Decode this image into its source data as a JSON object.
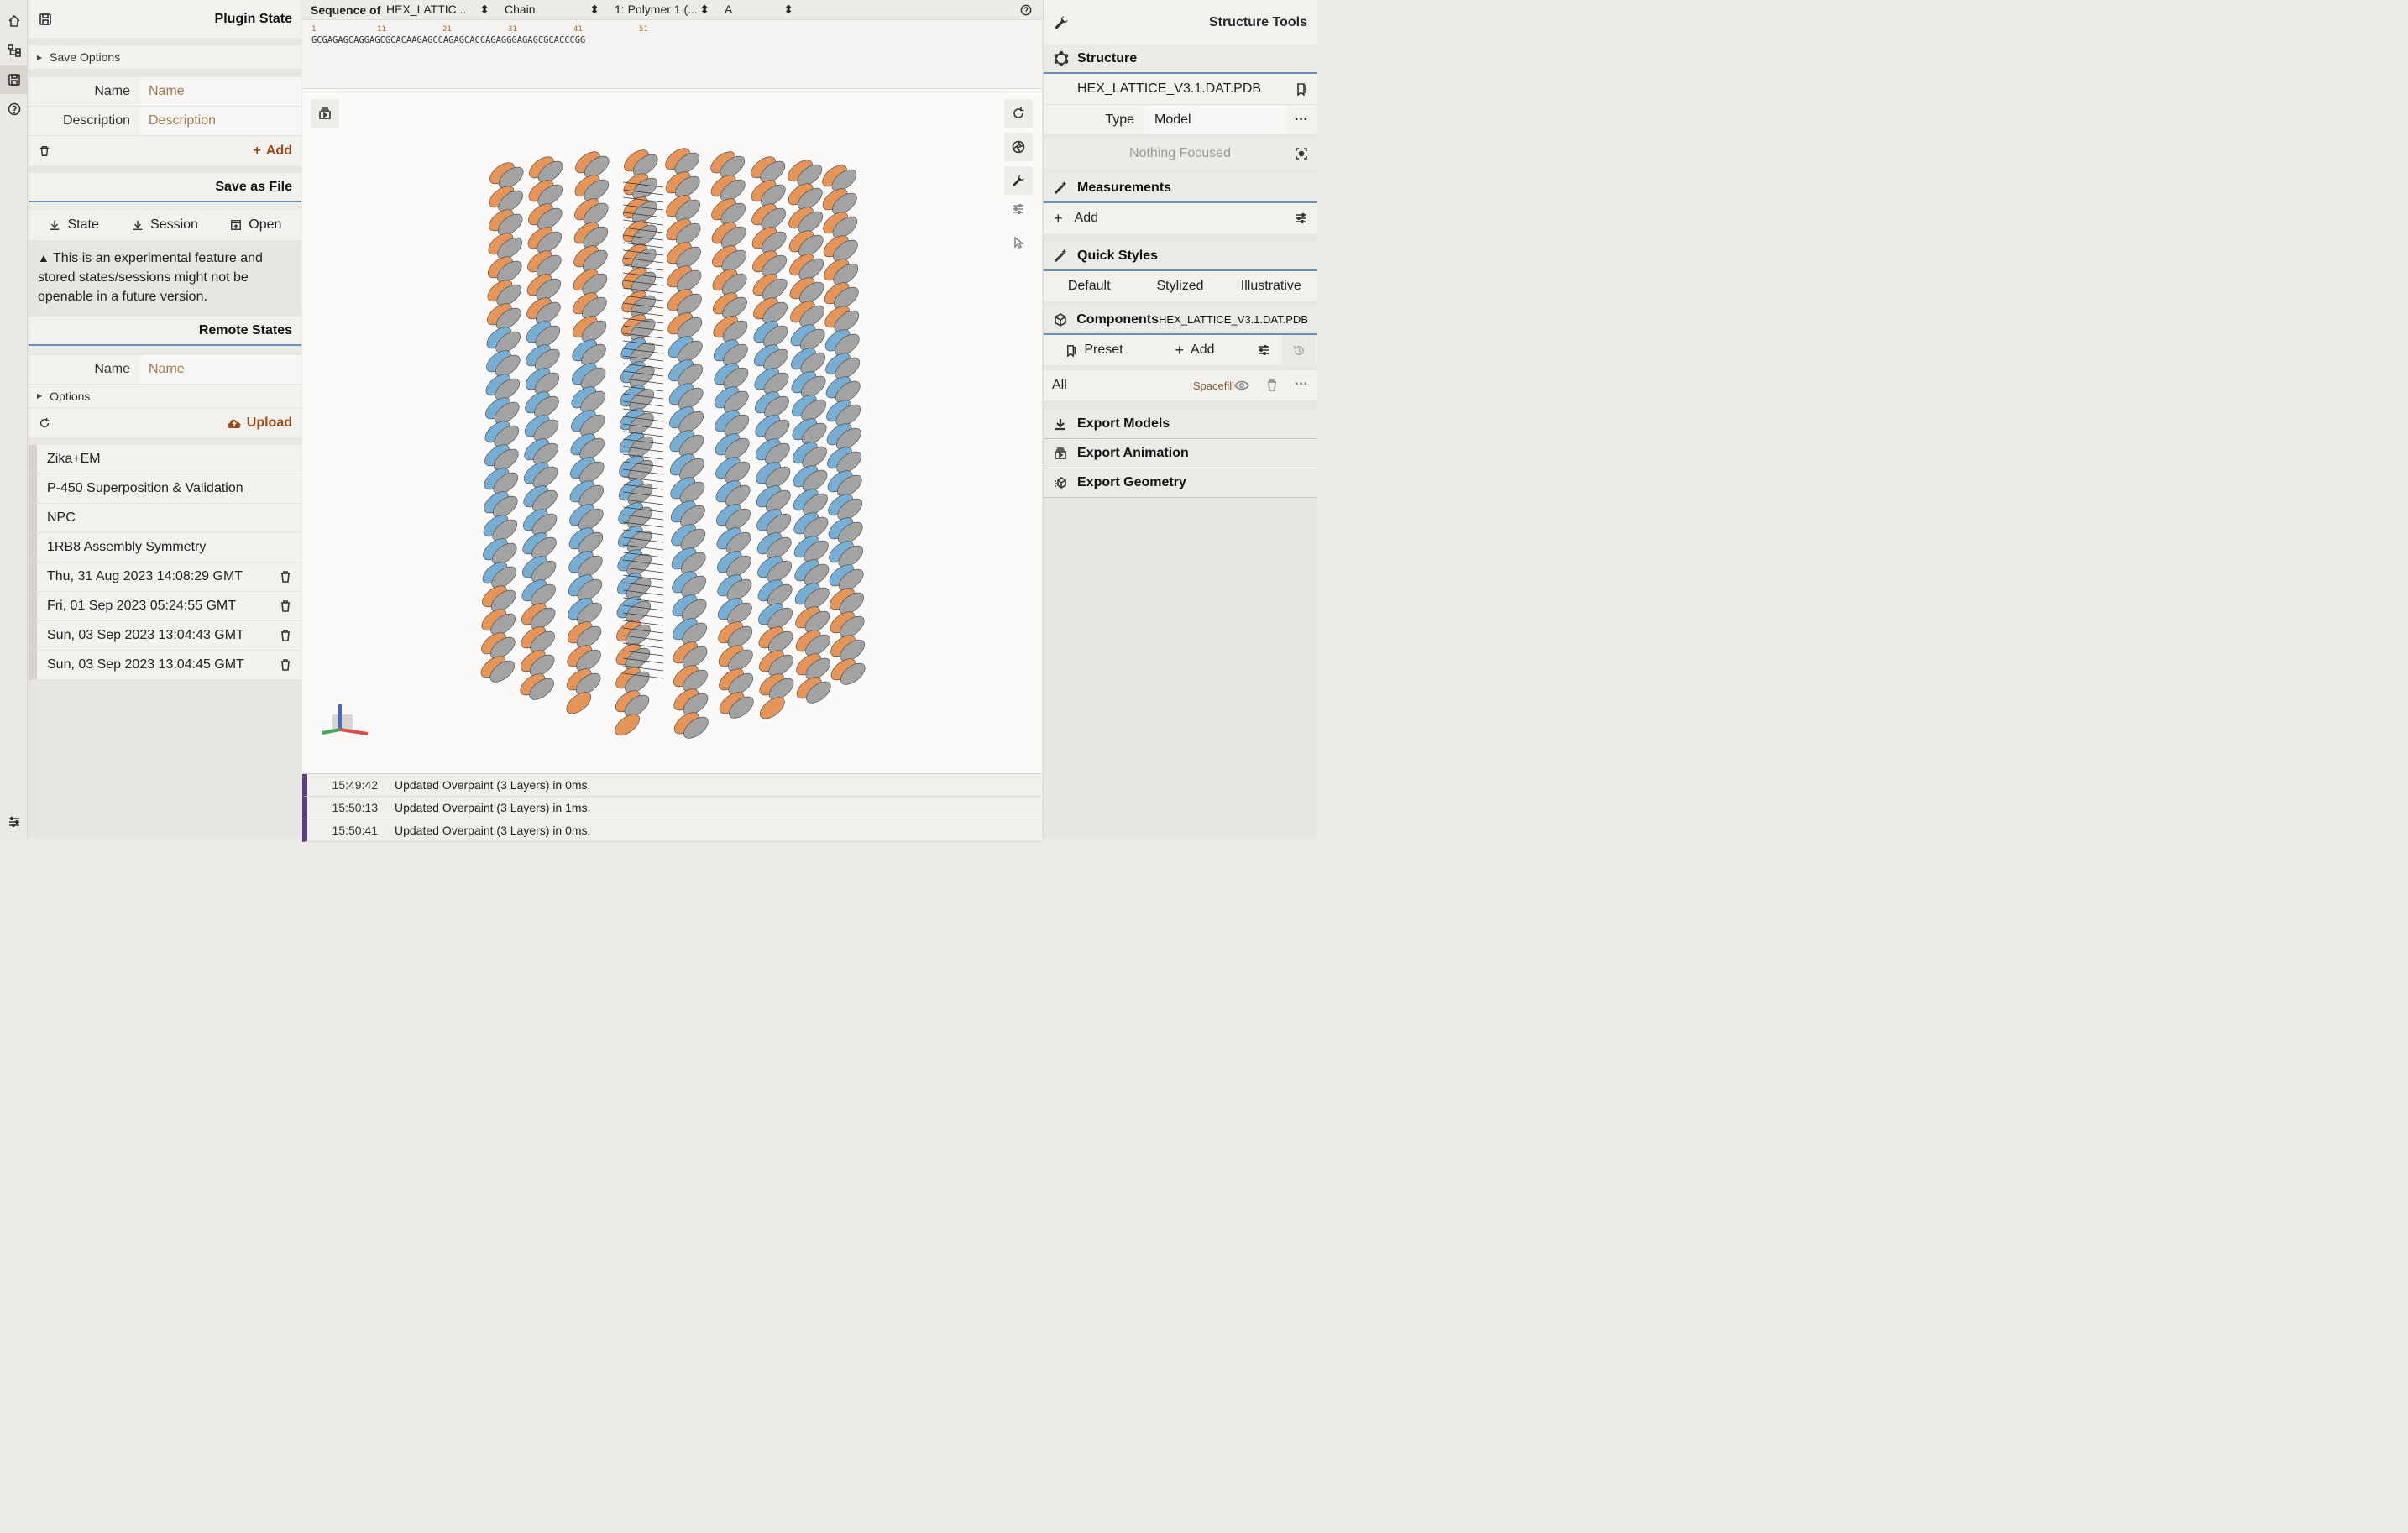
{
  "left_panel": {
    "header": "Plugin State",
    "save_options": "Save Options",
    "name_label": "Name",
    "name_placeholder": "Name",
    "description_label": "Description",
    "description_placeholder": "Description",
    "add_label": "Add",
    "save_as_file": "Save as File",
    "file_buttons": {
      "state": "State",
      "session": "Session",
      "open": "Open"
    },
    "warning": "This is an experimental feature and stored states/sessions might not be openable in a future version.",
    "remote_states": "Remote States",
    "remote_name_label": "Name",
    "remote_name_placeholder": "Name",
    "options": "Options",
    "upload": "Upload",
    "states": [
      "Zika+EM",
      "P-450 Superposition & Validation",
      "NPC",
      "1RB8 Assembly Symmetry",
      "Thu, 31 Aug 2023 14:08:29 GMT",
      "Fri, 01 Sep 2023 05:24:55 GMT",
      "Sun, 03 Sep 2023 13:04:43 GMT",
      "Sun, 03 Sep 2023 13:04:45 GMT"
    ]
  },
  "sequence": {
    "label": "Sequence of",
    "structure_select": "HEX_LATTIC...",
    "mode_select": "Chain",
    "entity_select": "1: Polymer 1 (...",
    "chain_select": "A",
    "numbers": [
      "1",
      "11",
      "21",
      "31",
      "41",
      "51"
    ],
    "residues": "GCGAGAGCAGGAGCGCACAAGAGCCAGAGCACCAGAGGGAGAGCGCACCCGG"
  },
  "log": [
    {
      "time": "15:49:42",
      "message": "Updated Overpaint (3 Layers) in 0ms."
    },
    {
      "time": "15:50:13",
      "message": "Updated Overpaint (3 Layers) in 1ms."
    },
    {
      "time": "15:50:41",
      "message": "Updated Overpaint (3 Layers) in 0ms."
    }
  ],
  "right_panel": {
    "title": "Structure Tools",
    "structure_section": "Structure",
    "structure_name": "HEX_LATTICE_V3.1.DAT.PDB",
    "type_label": "Type",
    "type_value": "Model",
    "nothing_focused": "Nothing Focused",
    "measurements": "Measurements",
    "measurements_add": "Add",
    "quick_styles": "Quick Styles",
    "styles": [
      "Default",
      "Stylized",
      "Illustrative"
    ],
    "components": "Components",
    "components_structure": "HEX_LATTICE_V3.1.DAT.PDB",
    "preset": "Preset",
    "components_add": "Add",
    "component_all": "All",
    "component_repr": "Spacefill",
    "export_models": "Export Models",
    "export_animation": "Export Animation",
    "export_geometry": "Export Geometry"
  },
  "colors": {
    "accent_orange": "#9a4a16",
    "placeholder": "#a07c50",
    "log_bar": "#5c3d7d",
    "dna_orange": "#e6955a",
    "dna_blue": "#78aed4",
    "dna_gray": "#a3a3a3"
  }
}
